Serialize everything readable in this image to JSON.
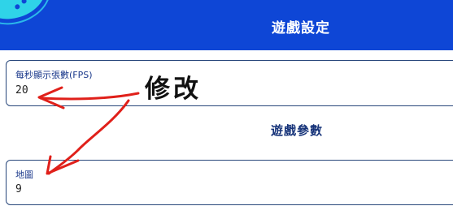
{
  "header": {
    "title": "遊戲設定"
  },
  "fields": {
    "fps": {
      "label": "每秒顯示張數(FPS)",
      "value": "20"
    },
    "map": {
      "label": "地圖",
      "value": "9"
    }
  },
  "section": {
    "title": "遊戲參數"
  },
  "annotation": {
    "text": "修改",
    "color": "#e0201a"
  },
  "colors": {
    "header_bg": "#0e46d6",
    "field_border": "#27467a",
    "label": "#1c3a8c"
  }
}
